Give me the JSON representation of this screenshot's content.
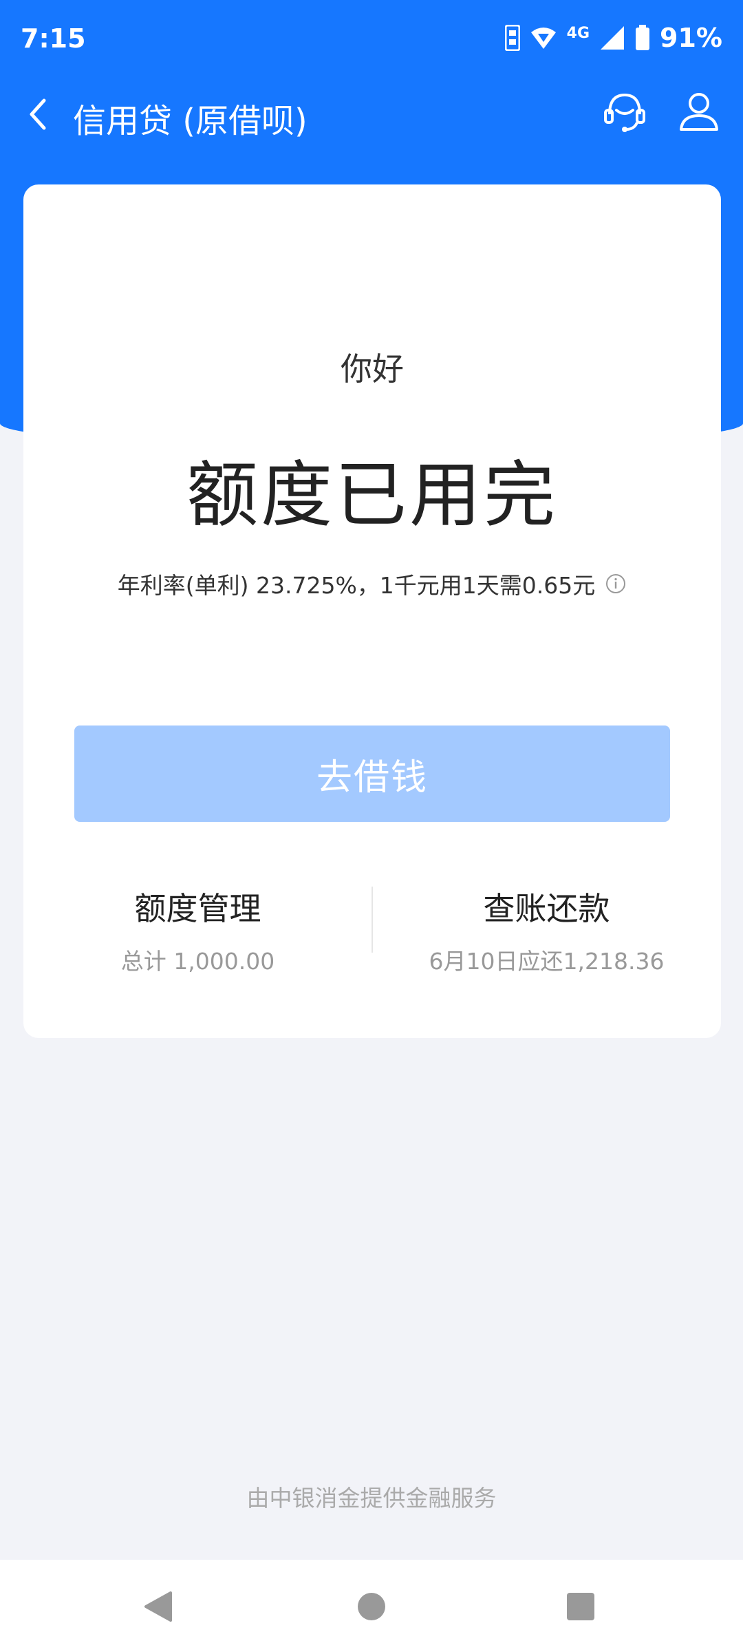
{
  "status_bar": {
    "time": "7:15",
    "network": "4G",
    "battery": "91%"
  },
  "header": {
    "title": "信用贷 (原借呗)",
    "back_icon": "chevron-left-icon",
    "support_icon": "headset-icon",
    "profile_icon": "user-icon"
  },
  "card": {
    "greeting": "你好",
    "status_title": "额度已用完",
    "rate_text": "年利率(单利) 23.725%，1千元用1天需0.65元",
    "info_icon": "info-icon",
    "borrow_button": "去借钱",
    "quota": {
      "title": "额度管理",
      "subtitle": "总计 1,000.00"
    },
    "repay": {
      "title": "查账还款",
      "subtitle": "6月10日应还1,218.36"
    }
  },
  "footer": {
    "provider_text": "由中银消金提供金融服务"
  },
  "colors": {
    "brand_blue": "#1677ff",
    "button_disabled": "#a3c9ff",
    "page_bg": "#f2f3f8"
  }
}
